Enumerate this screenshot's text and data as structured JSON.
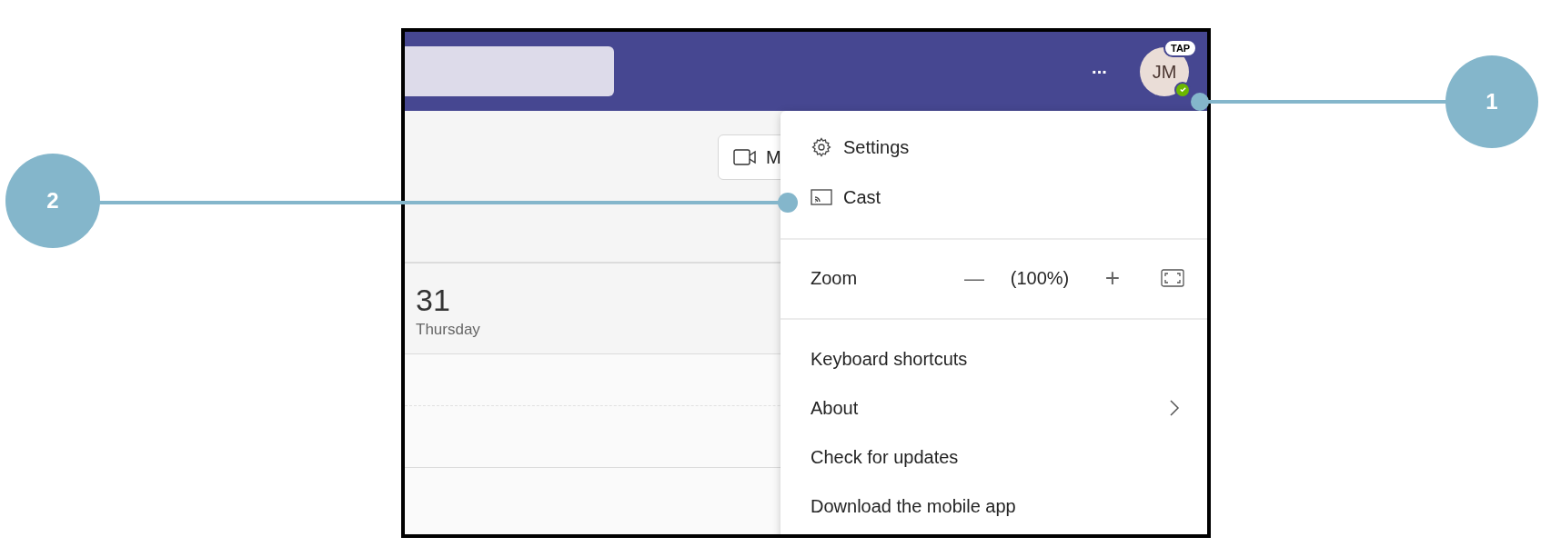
{
  "top_bar": {
    "more_label": "···",
    "avatar": {
      "initials": "JM",
      "badge": "TAP",
      "online": true
    }
  },
  "meet_button": {
    "label": "M"
  },
  "calendar": {
    "day_number": "31",
    "weekday": "Thursday"
  },
  "menu": {
    "top_items": [
      {
        "label": "Settings",
        "kind": "settings"
      },
      {
        "label": "Cast",
        "kind": "cast"
      }
    ],
    "zoom": {
      "label": "Zoom",
      "decrease": "—",
      "value": "(100%)",
      "increase": "+"
    },
    "items": [
      {
        "label": "Keyboard shortcuts",
        "has_submenu": false
      },
      {
        "label": "About",
        "has_submenu": true
      },
      {
        "label": "Check for updates",
        "has_submenu": false
      },
      {
        "label": "Download the mobile app",
        "has_submenu": false
      }
    ]
  },
  "callouts": [
    {
      "number": "1"
    },
    {
      "number": "2"
    }
  ]
}
